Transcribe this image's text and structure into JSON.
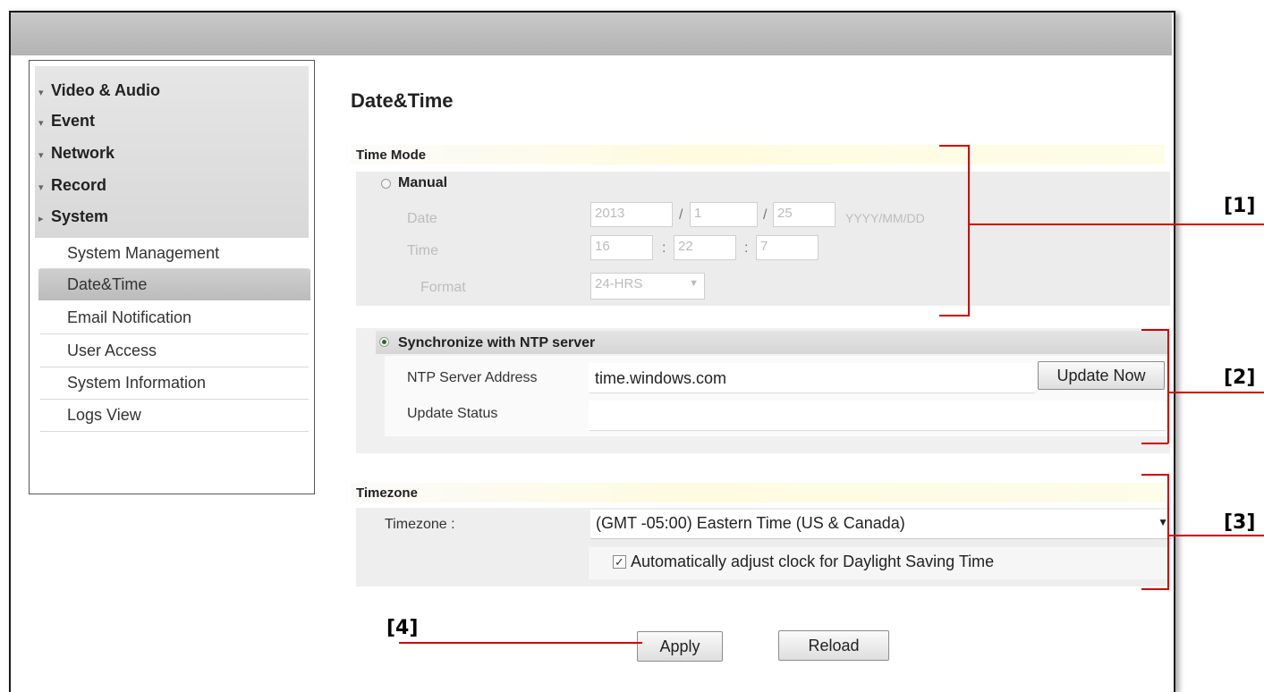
{
  "sidebar": {
    "categories": [
      {
        "label": "Video & Audio",
        "arrow": "▾"
      },
      {
        "label": "Event",
        "arrow": "▾"
      },
      {
        "label": "Network",
        "arrow": "▾"
      },
      {
        "label": "Record",
        "arrow": "▾"
      },
      {
        "label": "System",
        "arrow": "▸"
      }
    ],
    "system_items": [
      {
        "label": "System Management",
        "active": false
      },
      {
        "label": "Date&Time",
        "active": true
      },
      {
        "label": "Email Notification",
        "active": false
      },
      {
        "label": "User Access",
        "active": false
      },
      {
        "label": "System Information",
        "active": false
      },
      {
        "label": "Logs View",
        "active": false
      }
    ]
  },
  "page": {
    "title": "Date&Time"
  },
  "time_mode": {
    "heading": "Time Mode",
    "manual_label": "Manual",
    "manual_selected": false,
    "date_label": "Date",
    "date_year": "2013",
    "date_month": "1",
    "date_day": "25",
    "date_sep": "/",
    "date_format_hint": "YYYY/MM/DD",
    "time_label": "Time",
    "time_hour": "16",
    "time_min": "22",
    "time_sec": "7",
    "time_sep": ":",
    "format_label": "Format",
    "format_value": "24-HRS"
  },
  "ntp": {
    "label": "Synchronize with NTP server",
    "selected": true,
    "server_label": "NTP Server Address",
    "server_value": "time.windows.com",
    "update_button": "Update Now",
    "status_label": "Update Status",
    "status_value": ""
  },
  "timezone": {
    "heading": "Timezone",
    "label": "Timezone :",
    "value": "(GMT -05:00) Eastern Time (US & Canada)",
    "dst_label": "Automatically adjust clock for Daylight Saving Time",
    "dst_checked": true
  },
  "actions": {
    "apply": "Apply",
    "reload": "Reload"
  },
  "annotations": {
    "a1": "[1]",
    "a2": "[2]",
    "a3": "[3]",
    "a4": "[4]"
  },
  "colors": {
    "annotation_line": "#d00000",
    "selected_bg": "#c4c4c4",
    "band": "#ececec"
  }
}
